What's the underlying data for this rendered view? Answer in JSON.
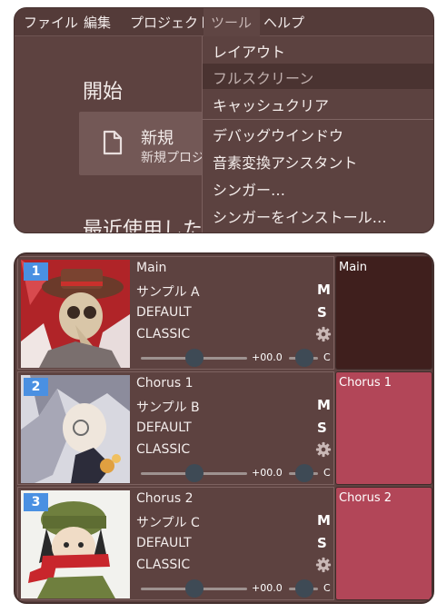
{
  "menubar": {
    "file": "ファイル",
    "edit": "編集",
    "project": "プロジェクト",
    "tools": "ツール",
    "help": "ヘルプ"
  },
  "tools_menu": {
    "items": [
      "レイアウト",
      "フルスクリーン",
      "キャッシュクリア",
      "デバッグウインドウ",
      "音素変換アシスタント",
      "シンガー…",
      "シンガーをインストール…"
    ]
  },
  "start": {
    "title": "開始",
    "new_title": "新規",
    "new_subtitle": "新規プロジェ",
    "recent_title": "最近使用した"
  },
  "tracks": [
    {
      "number": "1",
      "name": "Main",
      "singer": "サンプル A",
      "phonemizer": "DEFAULT",
      "renderer": "CLASSIC",
      "mute": "M",
      "solo": "S",
      "volume": "+00.0",
      "pan": "C",
      "part_label": "Main",
      "part_color": "#3f1f1d",
      "avatar_bg": "#b02428"
    },
    {
      "number": "2",
      "name": "Chorus 1",
      "singer": "サンプル B",
      "phonemizer": "DEFAULT",
      "renderer": "CLASSIC",
      "mute": "M",
      "solo": "S",
      "volume": "+00.0",
      "pan": "C",
      "part_label": "Chorus 1",
      "part_color": "#b24658",
      "avatar_bg": "#d8d8e0"
    },
    {
      "number": "3",
      "name": "Chorus 2",
      "singer": "サンプル C",
      "phonemizer": "DEFAULT",
      "renderer": "CLASSIC",
      "mute": "M",
      "solo": "S",
      "volume": "+00.0",
      "pan": "C",
      "part_label": "Chorus 2",
      "part_color": "#b24658",
      "avatar_bg": "#f2f2ee"
    }
  ],
  "colors": {
    "window_bg": "#5d4240",
    "menu_hover": "#4a3331",
    "track_number_bg": "#4a90e2",
    "slider_thumb": "#3e4a55"
  },
  "icons": {
    "new": "document-icon",
    "settings": "gear-icon"
  }
}
